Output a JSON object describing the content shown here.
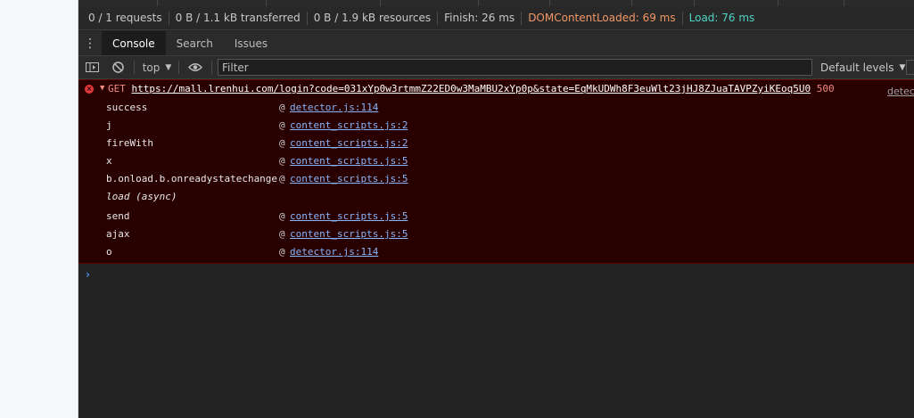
{
  "network_summary": {
    "requests": "0 / 1 requests",
    "transferred": "0 B / 1.1 kB transferred",
    "resources": "0 B / 1.9 kB resources",
    "finish": "Finish: 26 ms",
    "dom_content_loaded": "DOMContentLoaded: 69 ms",
    "load": "Load: 76 ms"
  },
  "tabs": [
    {
      "label": "Console",
      "active": true
    },
    {
      "label": "Search",
      "active": false
    },
    {
      "label": "Issues",
      "active": false
    }
  ],
  "toolbar": {
    "context": "top",
    "filter_placeholder": "Filter",
    "levels": "Default levels"
  },
  "error": {
    "method": "GET",
    "url": "https://mall.lrenhui.com/login?code=031xYp0w3rtmmZ22ED0w3MaMBU2xYp0p&state=EqMkUDWh8F3euWlt23jHJ8ZJuaTAVPZyiKEoq5U0",
    "status": "500",
    "source": "detec"
  },
  "stack": [
    {
      "fn": "success",
      "at": "@",
      "loc": "detector.js:114"
    },
    {
      "fn": "j",
      "at": "@",
      "loc": "content_scripts.js:2"
    },
    {
      "fn": "fireWith",
      "at": "@",
      "loc": "content_scripts.js:2"
    },
    {
      "fn": "x",
      "at": "@",
      "loc": "content_scripts.js:5"
    },
    {
      "fn": "b.onload.b.onreadystatechange",
      "at": "@",
      "loc": "content_scripts.js:5"
    },
    {
      "fn": "load (async)",
      "at": "",
      "loc": ""
    },
    {
      "fn": "send",
      "at": "@",
      "loc": "content_scripts.js:5"
    },
    {
      "fn": "ajax",
      "at": "@",
      "loc": "content_scripts.js:5"
    },
    {
      "fn": "o",
      "at": "@",
      "loc": "detector.js:114"
    }
  ],
  "prompt_symbol": "›",
  "colors": {
    "error_bg": "#290000",
    "error_text": "#f28b82",
    "link": "#8ab4f8",
    "dcl": "#f29766",
    "load": "#4fd3c4"
  },
  "icons": {
    "menu": "more-vertical-icon",
    "sidebar": "sidebar-toggle-icon",
    "clear": "clear-console-icon",
    "eye": "live-expression-icon",
    "error": "error-circle-icon"
  }
}
